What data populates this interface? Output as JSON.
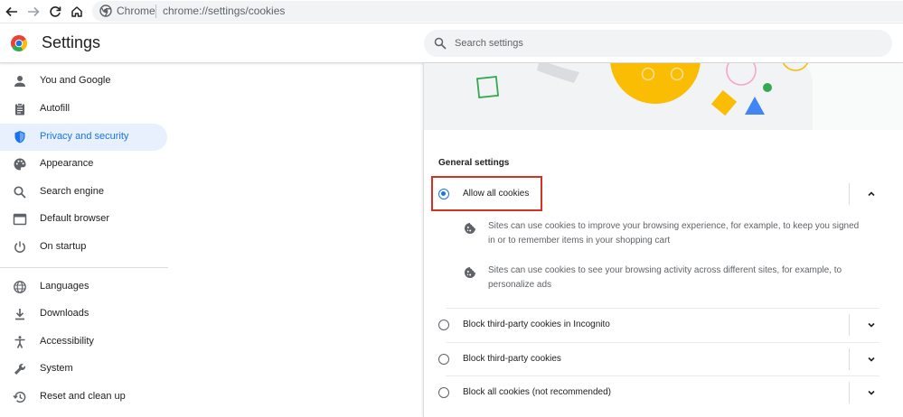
{
  "browser": {
    "chip": "Chrome",
    "url": "chrome://settings/cookies"
  },
  "header": {
    "title": "Settings",
    "search_placeholder": "Search settings"
  },
  "sidebar": {
    "items": [
      {
        "label": "You and Google",
        "icon": "person-icon"
      },
      {
        "label": "Autofill",
        "icon": "clipboard-icon"
      },
      {
        "label": "Privacy and security",
        "icon": "shield-icon",
        "active": true
      },
      {
        "label": "Appearance",
        "icon": "palette-icon"
      },
      {
        "label": "Search engine",
        "icon": "search-icon"
      },
      {
        "label": "Default browser",
        "icon": "browser-window-icon"
      },
      {
        "label": "On startup",
        "icon": "power-icon"
      },
      {
        "label": "Languages",
        "icon": "globe-icon"
      },
      {
        "label": "Downloads",
        "icon": "download-icon"
      },
      {
        "label": "Accessibility",
        "icon": "accessibility-icon"
      },
      {
        "label": "System",
        "icon": "wrench-icon"
      },
      {
        "label": "Reset and clean up",
        "icon": "history-icon"
      }
    ]
  },
  "main": {
    "section_title": "General settings",
    "options": [
      {
        "label": "Allow all cookies",
        "checked": true,
        "expanded": true
      },
      {
        "label": "Block third-party cookies in Incognito",
        "checked": false
      },
      {
        "label": "Block third-party cookies",
        "checked": false
      },
      {
        "label": "Block all cookies (not recommended)",
        "checked": false
      }
    ],
    "details": [
      "Sites can use cookies to improve your browsing experience, for example, to keep you signed in or to remember items in your shopping cart",
      "Sites can use cookies to see your browsing activity across different sites, for example, to personalize ads"
    ]
  },
  "colors": {
    "accent": "#1a73e8",
    "active_bg": "#e8f0fe",
    "highlight": "#d93025"
  }
}
